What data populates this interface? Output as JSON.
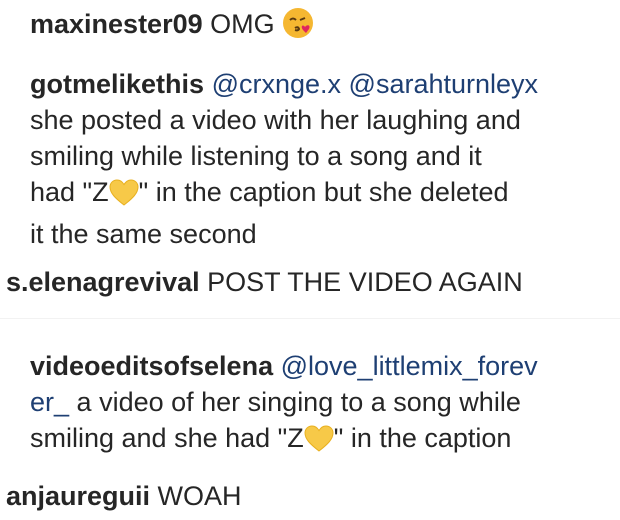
{
  "comments": [
    {
      "username": "maxinester09",
      "text": "OMG",
      "emoji": "face-blowing-kiss-icon"
    },
    {
      "username": "gotmelikethis",
      "mention1": "@crxnge.x",
      "mention2": "@sarahturnleyx",
      "line2": "she posted a video with her laughing and",
      "line3": "smiling while listening to a song and it",
      "line4_a": "had \"Z",
      "line4_b": "\" in the caption but she deleted",
      "line5": "it the same second",
      "emoji": "yellow-heart-icon"
    },
    {
      "username": "s.elenagrevival",
      "text": "POST THE VIDEO AGAIN"
    },
    {
      "username": "videoeditsofselena",
      "mention_part1": "@love_littlemix_forev",
      "mention_part2": "er_",
      "line2_rest": "a video of her singing to a song while",
      "line3_a": "smiling and she had \"Z",
      "line3_b": "\" in the caption",
      "emoji": "yellow-heart-icon"
    },
    {
      "username": "anjaureguii",
      "text": "WOAH"
    }
  ],
  "colors": {
    "text": "#262626",
    "mention": "#1e3f73",
    "heart": "#f7c948",
    "kiss_face": "#f5b731"
  }
}
